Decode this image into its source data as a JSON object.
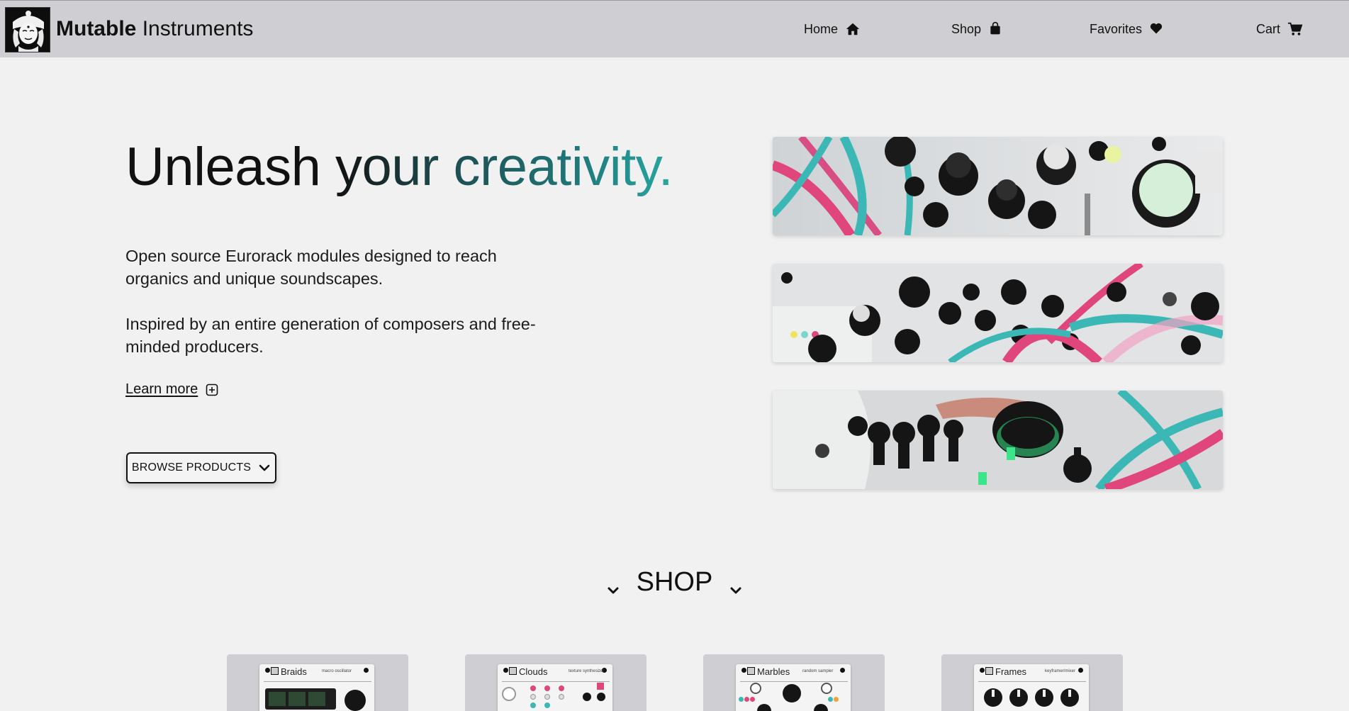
{
  "header": {
    "brand_bold": "Mutable",
    "brand_regular": "Instruments",
    "nav": [
      {
        "label": "Home",
        "icon": "home-icon"
      },
      {
        "label": "Shop",
        "icon": "shopping-bag-icon"
      },
      {
        "label": "Favorites",
        "icon": "heart-icon"
      },
      {
        "label": "Cart",
        "icon": "cart-icon"
      }
    ]
  },
  "hero": {
    "headline_plain": "Unleash",
    "headline_your": "your",
    "headline_accent": "creativity.",
    "paragraph1": "Open source Eurorack modules designed to reach organics and unique soundscapes.",
    "paragraph2": "Inspired by an entire generation of composers and free-minded producers.",
    "learn_more": "Learn more",
    "browse_button": "BROWSE PRODUCTS"
  },
  "shop": {
    "heading": "SHOP",
    "products": [
      {
        "name": "Braids",
        "subtitle": "macro oscillator"
      },
      {
        "name": "Clouds",
        "subtitle": "texture synthesizer"
      },
      {
        "name": "Marbles",
        "subtitle": "random sampler"
      },
      {
        "name": "Frames",
        "subtitle": "keyframer/mixer"
      }
    ]
  },
  "colors": {
    "header_bg": "#cfcfd3",
    "page_bg": "#f1f1f1",
    "accent_teal": "#1f7677",
    "cable_pink": "#e0457b",
    "cable_teal": "#3bb8b5"
  }
}
